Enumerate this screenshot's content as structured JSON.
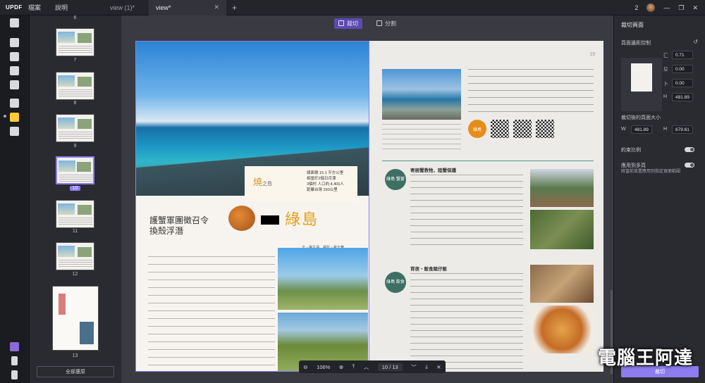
{
  "titlebar": {
    "logo": "UPDF",
    "menus": [
      "檔案",
      "說明"
    ],
    "tabs": [
      {
        "label": "view (1)*",
        "active": false
      },
      {
        "label": "view*",
        "active": true
      }
    ],
    "page_count_badge": "2",
    "close_glyph": "✕",
    "add_glyph": "+"
  },
  "thumbnails": {
    "items": [
      {
        "num": "6"
      },
      {
        "num": "7"
      },
      {
        "num": "8"
      },
      {
        "num": "9"
      },
      {
        "num": "10",
        "selected": true
      },
      {
        "num": "11"
      },
      {
        "num": "12"
      },
      {
        "num": "13"
      }
    ],
    "reset_button": "全部還原"
  },
  "toolbar": {
    "crop_label": "裁切",
    "split_label": "分割"
  },
  "document": {
    "left": {
      "fire_title": "燒",
      "fire_sub": "之島",
      "stats": [
        "總面積 15.1 平方公里",
        "相當於2個日月潭",
        "3個村 人口約 4,400人",
        "距離台灣 260公里"
      ],
      "big_title": "綠島",
      "subtitle": [
        "護蟹軍團徵召令",
        "換殼浮潛"
      ],
      "byline": "文・楊芷涵　攝影・羅正華"
    },
    "right": {
      "page_num": "19",
      "badge": "綠島",
      "section1_badge": "綠島\n蟹宴",
      "section1_head": "寄居蟹救牠，陸蟹保護",
      "section2_badge": "綠島\n飲食",
      "section2_head": "宵夜・飯食踏仔飯"
    }
  },
  "zoombar": {
    "zoom": "106%",
    "page_current": "10",
    "page_total": "13",
    "page_display": "10 / 13"
  },
  "right_panel": {
    "title": "裁切頁面",
    "margin_section": "頁面邊距控制",
    "fields": [
      {
        "icon": "匚",
        "value": "0.71"
      },
      {
        "icon": "모",
        "value": "0.00"
      },
      {
        "icon": "卜",
        "value": "0.00"
      },
      {
        "icon": "H",
        "value": "481.89"
      }
    ],
    "size_section": "裁切後的頁面大小",
    "width_label": "W",
    "width_value": "481.89",
    "height_label": "H",
    "height_value": "679.61",
    "ratio_label": "約束比例",
    "apply_all_label": "應用到多頁",
    "note": "將當前設置應用到指定頁面範圍",
    "apply_button": "裁切"
  },
  "watermark": "電腦王阿達"
}
